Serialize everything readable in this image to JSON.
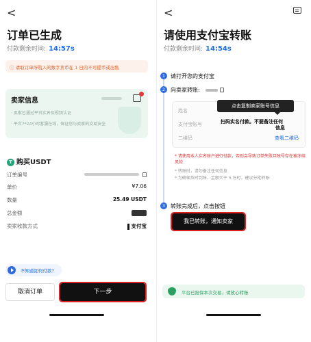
{
  "left": {
    "back": "<",
    "title": "订单已生成",
    "timer_label": "付款剩余时间:",
    "timer_value": "14:57s",
    "warning": "请取订单所购入的数字货币在 1 日内不可提币或出售",
    "seller": {
      "title": "卖家信息",
      "line1": "· 卖家已通过平台实名及视频认证",
      "line2": "· 平台7*24小时客服在线，保证您与卖家的交易安全"
    },
    "buy_title": "购买USDT",
    "rows": [
      {
        "label": "订单编号",
        "value": ""
      },
      {
        "label": "单价",
        "value": "¥7.06"
      },
      {
        "label": "数量",
        "value": "25.49 USDT"
      },
      {
        "label": "总金额",
        "value": ""
      },
      {
        "label": "卖家收款方式",
        "value": "支付宝"
      }
    ],
    "how_link": "不知道如何付款？",
    "cancel_label": "取消订单",
    "next_label": "下一步"
  },
  "right": {
    "back": "<",
    "title": "请使用支付宝转账",
    "timer_label": "付款剩余时间:",
    "timer_value": "14:54s",
    "step1": "请打开您的支付宝",
    "step2": "向卖家转账:",
    "tooltip": "点击复制卖家账号信息",
    "card": {
      "name_label": "姓名",
      "account_label": "支付宝账号",
      "account_note_1": "扫码实名付款。不要备注任何",
      "account_note_2": "信息",
      "qr_label": "二维码",
      "qr_link": "查看二维码"
    },
    "notes": [
      "* 请使用本人实名账户进行付款，否则会导致订单失败且账号存在被冻结风险",
      "* 转账时，请勿备注任何信息",
      "* 为确保及时到账，金额大于 5 万时，建议分批转账"
    ],
    "step3": "转账完成后，点击按钮",
    "done_label": "我已转账，通知卖家",
    "safe_text": "平台已担保本次交易，请放心转账"
  }
}
